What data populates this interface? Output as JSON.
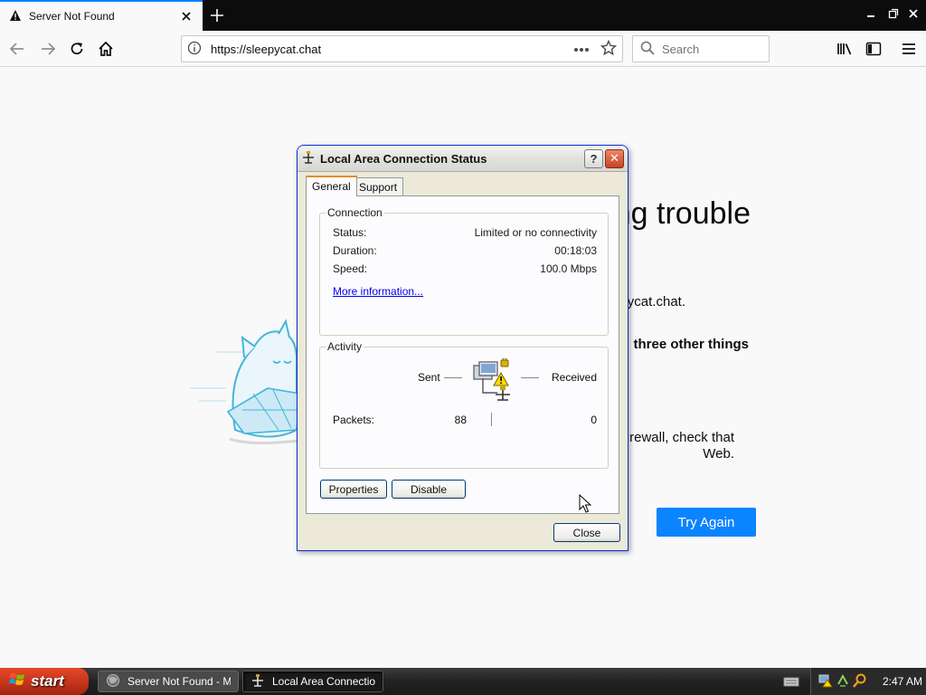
{
  "browser": {
    "tab": {
      "title": "Server Not Found"
    },
    "url": "https://sleepycat.chat",
    "search": {
      "placeholder": "Search"
    }
  },
  "page": {
    "title_fragment": "ng trouble",
    "desc_fragment": "ycat.chat.",
    "tips_fragment": "three other things",
    "firewall_fragment_1": "firewall, check that",
    "firewall_fragment_2": "Web.",
    "try_again": "Try Again"
  },
  "dialog": {
    "title": "Local Area Connection Status",
    "help": "?",
    "close_x": "✕",
    "tabs": [
      "General",
      "Support"
    ],
    "connection": {
      "legend": "Connection",
      "rows": [
        {
          "label": "Status:",
          "value": "Limited or no connectivity"
        },
        {
          "label": "Duration:",
          "value": "00:18:03"
        },
        {
          "label": "Speed:",
          "value": "100.0 Mbps"
        }
      ],
      "more_info": "More information..."
    },
    "activity": {
      "legend": "Activity",
      "sent_label": "Sent",
      "received_label": "Received",
      "packets_label": "Packets:",
      "packets_sent": "88",
      "packets_received": "0"
    },
    "buttons": {
      "properties": "Properties",
      "disable": "Disable",
      "close": "Close"
    }
  },
  "taskbar": {
    "start": "start",
    "tasks": [
      "Server Not Found - M...",
      "Local Area Connectio..."
    ],
    "clock": "2:47 AM"
  },
  "colors": {
    "accent": "#0a84ff",
    "xp_title_border": "#0831d9",
    "start_red": "#c1321a"
  }
}
